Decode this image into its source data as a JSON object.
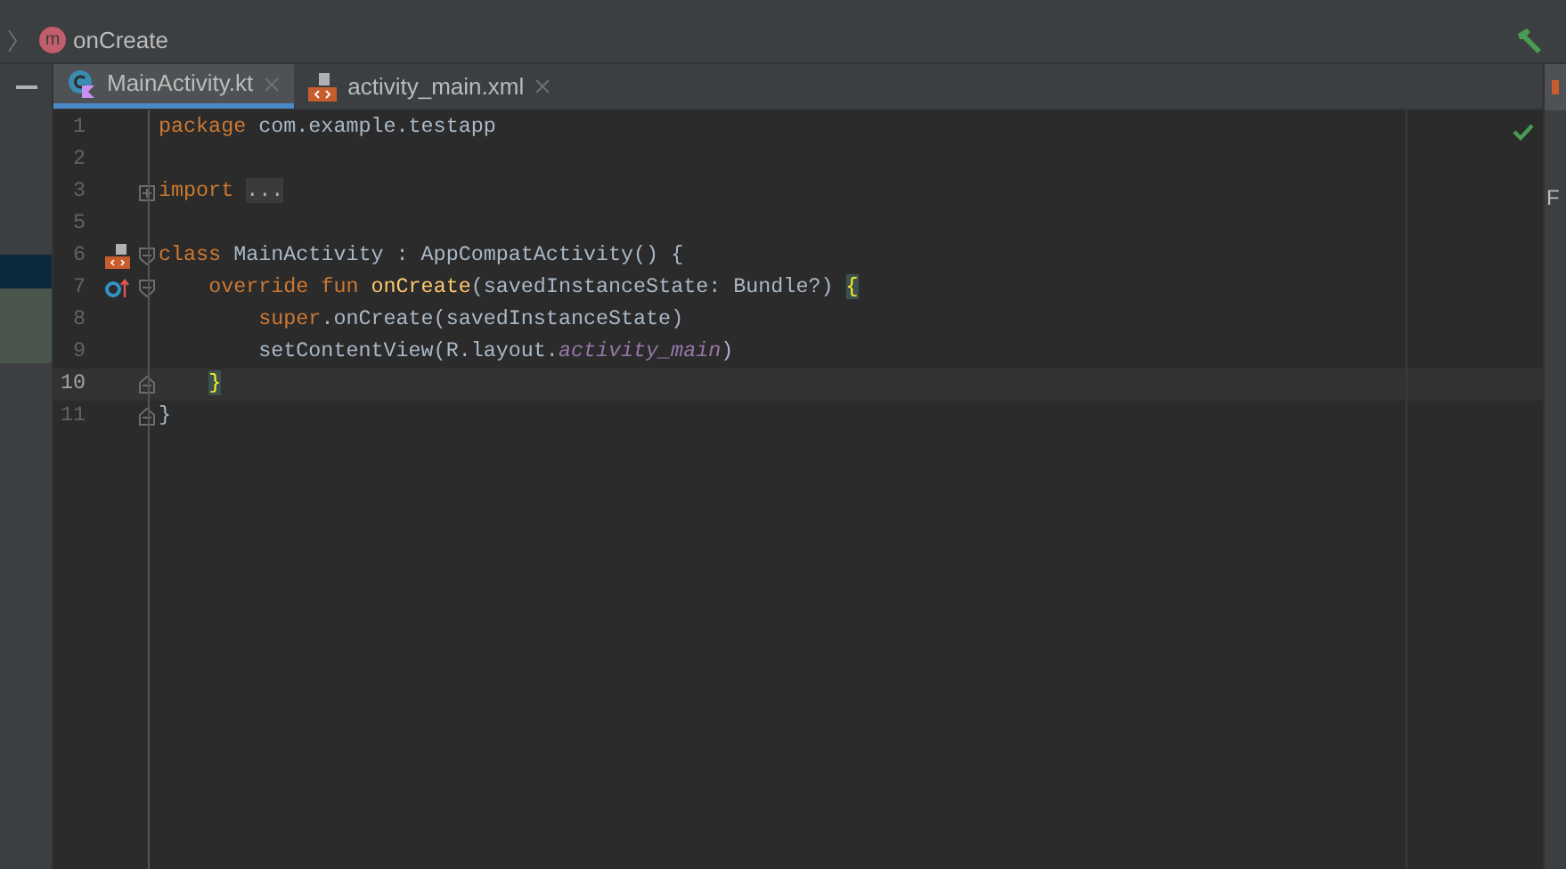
{
  "breadcrumb": {
    "method": "onCreate",
    "badge": "m"
  },
  "tabs": [
    {
      "label": "MainActivity.kt",
      "kind": "kotlin",
      "selected": true
    },
    {
      "label": "activity_main.xml",
      "kind": "xml",
      "selected": false
    }
  ],
  "lines": [
    {
      "number": "1",
      "current": false,
      "tokens": [
        {
          "kind": "keyword",
          "text": "package "
        },
        {
          "kind": "plain",
          "text": "com.example.testapp"
        }
      ]
    },
    {
      "number": "2",
      "current": false
    },
    {
      "number": "3",
      "current": false,
      "fold": {
        "kind": "collapsed"
      },
      "tokens": [
        {
          "kind": "keyword",
          "text": "import "
        },
        {
          "kind": "folded",
          "text": "..."
        }
      ]
    },
    {
      "number": "5",
      "current": false
    },
    {
      "number": "6",
      "current": false,
      "gutter_icon": {
        "kind": "layout"
      },
      "fold": {
        "kind": "open"
      },
      "tokens": [
        {
          "kind": "keyword",
          "text": "class "
        },
        {
          "kind": "plain",
          "text": "MainActivity : AppCompatActivity() {"
        }
      ]
    },
    {
      "number": "7",
      "current": false,
      "gutter_icon": {
        "kind": "override"
      },
      "fold": {
        "kind": "open"
      },
      "tokens": [
        {
          "kind": "keyword",
          "text": "    override fun "
        },
        {
          "kind": "declaration",
          "text": "onCreate"
        },
        {
          "kind": "plain",
          "text": "(savedInstanceState: Bundle?) "
        },
        {
          "kind": "brace",
          "text": "{"
        }
      ]
    },
    {
      "number": "8",
      "current": false,
      "tokens": [
        {
          "kind": "keyword",
          "text": "        super"
        },
        {
          "kind": "plain",
          "text": ".onCreate(savedInstanceState)"
        }
      ]
    },
    {
      "number": "9",
      "current": false,
      "tokens": [
        {
          "kind": "plain",
          "text": "        setContentView(R.layout."
        },
        {
          "kind": "field",
          "text": "activity_main"
        },
        {
          "kind": "plain",
          "text": ")"
        }
      ]
    },
    {
      "number": "10",
      "current": true,
      "fold": {
        "kind": "end"
      },
      "tokens": [
        {
          "kind": "brace",
          "text": "    }"
        }
      ]
    },
    {
      "number": "11",
      "current": false,
      "fold": {
        "kind": "end"
      },
      "tokens": [
        {
          "kind": "plain",
          "text": "}"
        }
      ]
    }
  ],
  "right_panel": {
    "label": "F"
  }
}
